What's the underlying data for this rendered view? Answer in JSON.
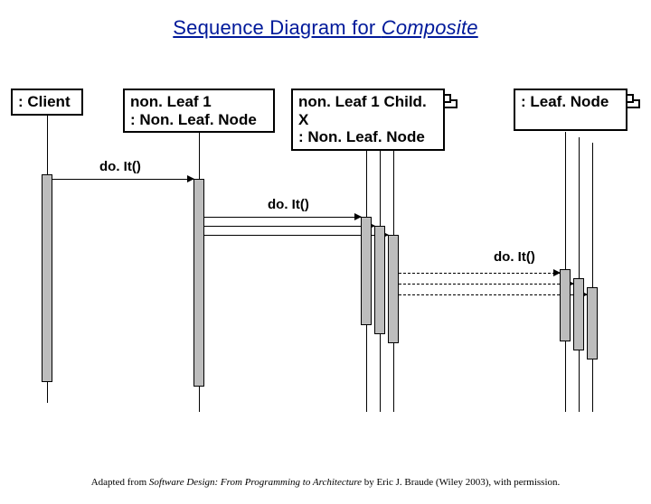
{
  "title_pre": "Sequence Diagram for ",
  "title_em": "Composite",
  "client_label": ": Client",
  "p1_l1": "non. Leaf 1",
  "p1_l2": ": Non. Leaf. Node",
  "p2_l1": "non. Leaf 1 Child. X",
  "p2_l2": ": Non. Leaf. Node",
  "p3_l1": " : Leaf. Node",
  "m1": "do. It()",
  "m2": "do. It()",
  "m3": "do. It()",
  "attr_pre": "Adapted from ",
  "attr_em": "Software Design: From Programming to Architecture",
  "attr_post": " by Eric J. Braude (Wiley 2003), with permission."
}
